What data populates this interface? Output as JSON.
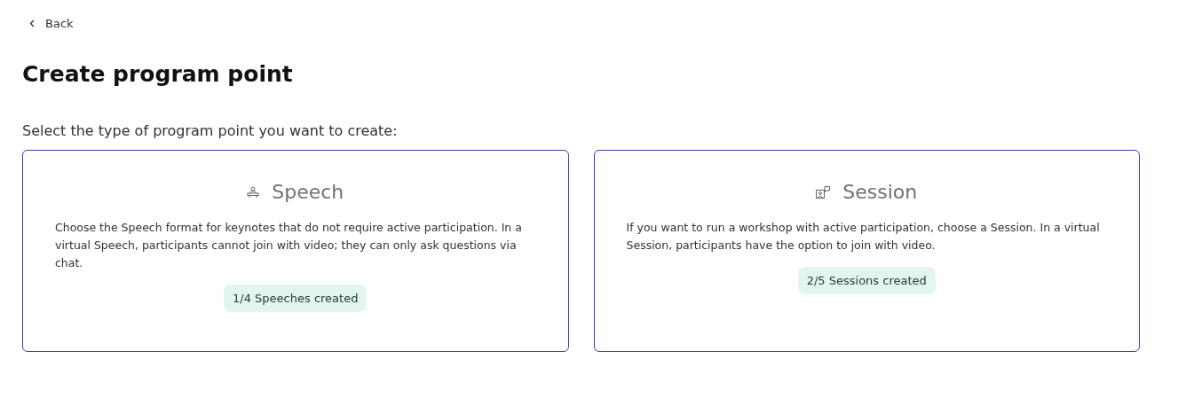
{
  "back_link": {
    "label": "Back"
  },
  "title": "Create program point",
  "prompt": "Select the type of program point you want to create:",
  "cards": [
    {
      "kind": "speech",
      "title": "Speech",
      "description": "Choose the Speech format for keynotes that do not require active participation. In a virtual Speech, participants cannot join with video; they can only ask questions via chat.",
      "badge": "1/4 Speeches created"
    },
    {
      "kind": "session",
      "title": "Session",
      "description": "If you want to run a workshop with active participation, choose a Session. In a virtual Session, participants have the option to join with video.",
      "badge": "2/5 Sessions created"
    }
  ]
}
